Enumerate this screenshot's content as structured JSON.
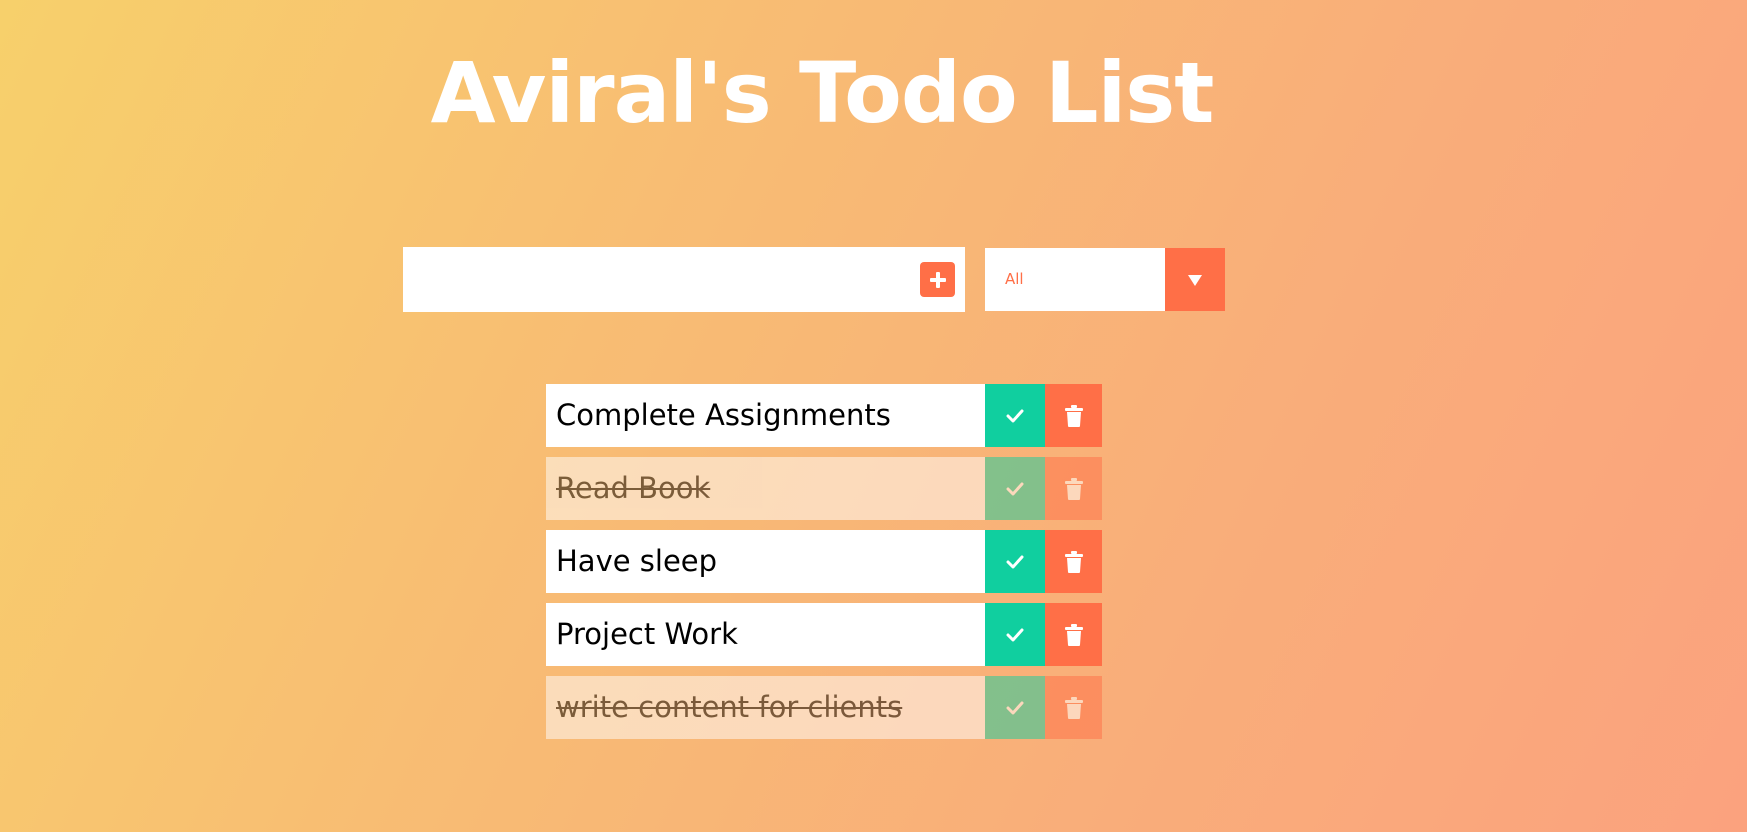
{
  "header": {
    "title": "Aviral's Todo List"
  },
  "form": {
    "input_value": "",
    "input_placeholder": "",
    "add_icon": "plus-icon"
  },
  "filter": {
    "selected": "All",
    "arrow_icon": "caret-down-icon"
  },
  "todos": [
    {
      "text": "Complete Assignments",
      "completed": false
    },
    {
      "text": "Read Book",
      "completed": true
    },
    {
      "text": "Have sleep",
      "completed": false
    },
    {
      "text": "Project Work",
      "completed": false
    },
    {
      "text": "write content for clients",
      "completed": true
    }
  ],
  "colors": {
    "accent": "#ff6f47",
    "check": "#10cf9f",
    "background_start": "#f7d06b",
    "background_end": "#fba27e"
  }
}
